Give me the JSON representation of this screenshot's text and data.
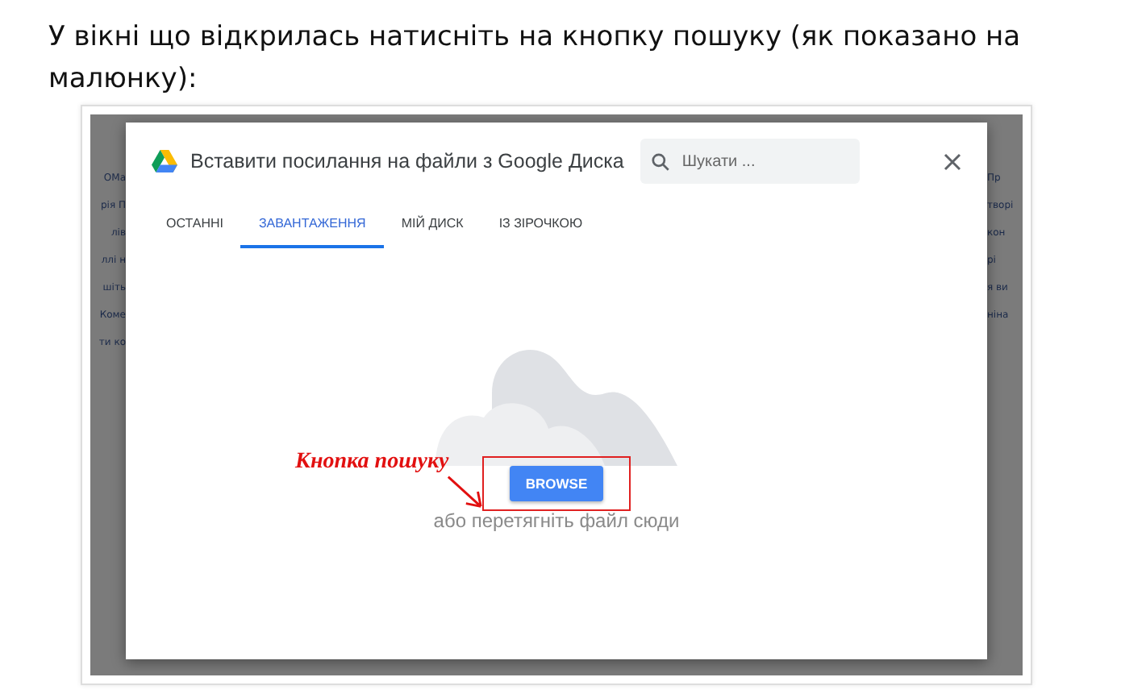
{
  "instruction": "У вікні що відкрилась натисніть на кнопку пошуку (як показано на малюнку):",
  "background": {
    "left": [
      "ОМа",
      "рія П",
      "лів",
      "ллі н",
      "шіть",
      "Коме",
      "ти ко"
    ],
    "right": [
      "Пр",
      "творі",
      "кон",
      "рі",
      "я ви",
      "ніна"
    ]
  },
  "dialog": {
    "title": "Вставити посилання на файли з Google Диска",
    "search": {
      "placeholder": "Шукати ..."
    },
    "tabs": [
      {
        "label": "ОСТАННІ",
        "selected": false
      },
      {
        "label": "ЗАВАНТАЖЕННЯ",
        "selected": true
      },
      {
        "label": "МІЙ ДИСК",
        "selected": false
      },
      {
        "label": "ІЗ ЗІРОЧКОЮ",
        "selected": false
      }
    ],
    "browse_button": "BROWSE",
    "drop_hint": "або перетягніть файл сюди",
    "annotation": "Кнопка пошуку"
  }
}
